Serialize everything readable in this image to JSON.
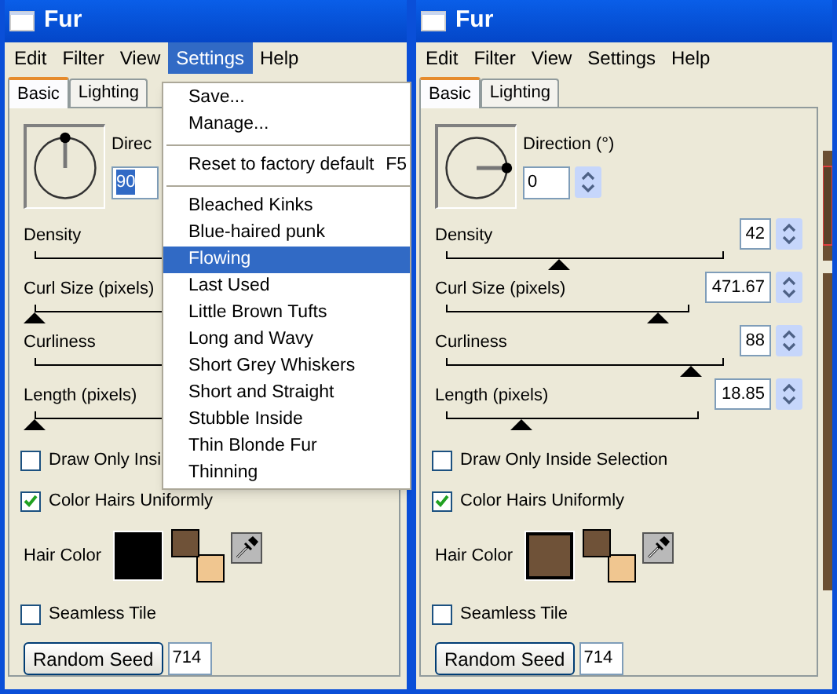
{
  "windows": [
    {
      "title": "Fur",
      "menus": [
        {
          "label": "Edit",
          "selected": false
        },
        {
          "label": "Filter",
          "selected": false
        },
        {
          "label": "View",
          "selected": false
        },
        {
          "label": "Settings",
          "selected": true
        },
        {
          "label": "Help",
          "selected": false
        }
      ],
      "tabs": [
        {
          "label": "Basic",
          "selected": true
        },
        {
          "label": "Lighting",
          "selected": false
        }
      ],
      "direction": {
        "label": "Direc",
        "value": "90",
        "value_selected": true
      },
      "sliders": [
        {
          "label": "Density"
        },
        {
          "label": "Curl Size (pixels)",
          "level": 0
        },
        {
          "label": "Curliness"
        },
        {
          "label": "Length (pixels)",
          "level": 0
        }
      ],
      "checkboxes": [
        {
          "label": "Draw Only Insi",
          "checked": false
        },
        {
          "label": "Color Hairs Uniformly",
          "checked": true
        }
      ],
      "hair_color": {
        "label": "Hair Color",
        "color": "#000000",
        "swatches": [
          {
            "color": "#6f5238"
          },
          {
            "color": "#f0c690"
          }
        ]
      },
      "seamless_tile": {
        "label": "Seamless Tile",
        "checked": false
      },
      "random_seed": {
        "label": "Random Seed",
        "value": "714"
      },
      "open_menu": [
        {
          "kind": "item",
          "label": "Save...",
          "selected": false
        },
        {
          "kind": "item",
          "label": "Manage...",
          "selected": false
        },
        {
          "kind": "separator"
        },
        {
          "kind": "item",
          "label": "Reset to factory default",
          "shortcut": "F5",
          "selected": false
        },
        {
          "kind": "separator"
        },
        {
          "kind": "item",
          "label": "Bleached Kinks",
          "selected": false
        },
        {
          "kind": "item",
          "label": "Blue-haired punk",
          "selected": false
        },
        {
          "kind": "item",
          "label": "Flowing",
          "selected": true
        },
        {
          "kind": "item",
          "label": "Last Used",
          "selected": false
        },
        {
          "kind": "item",
          "label": "Little Brown Tufts",
          "selected": false
        },
        {
          "kind": "item",
          "label": "Long and Wavy",
          "selected": false
        },
        {
          "kind": "item",
          "label": "Short Grey Whiskers",
          "selected": false
        },
        {
          "kind": "item",
          "label": "Short and Straight",
          "selected": false
        },
        {
          "kind": "item",
          "label": "Stubble Inside",
          "selected": false
        },
        {
          "kind": "item",
          "label": "Thin Blonde Fur",
          "selected": false
        },
        {
          "kind": "item",
          "label": "Thinning",
          "selected": false
        }
      ]
    },
    {
      "title": "Fur",
      "menus": [
        {
          "label": "Edit",
          "selected": false
        },
        {
          "label": "Filter",
          "selected": false
        },
        {
          "label": "View",
          "selected": false
        },
        {
          "label": "Settings",
          "selected": false
        },
        {
          "label": "Help",
          "selected": false
        }
      ],
      "tabs": [
        {
          "label": "Basic",
          "selected": true
        },
        {
          "label": "Lighting",
          "selected": false
        }
      ],
      "direction": {
        "label": "Direction (°)",
        "value": "0",
        "value_selected": false
      },
      "sliders": [
        {
          "label": "Density",
          "level": 0.41,
          "value": "42"
        },
        {
          "label": "Curl Size (pixels)",
          "level": 0.87,
          "value": "471.67"
        },
        {
          "label": "Curliness",
          "level": 0.88,
          "value": "88"
        },
        {
          "label": "Length (pixels)",
          "level": 0.3,
          "value": "18.85"
        }
      ],
      "checkboxes": [
        {
          "label": "Draw Only Inside Selection",
          "checked": false
        },
        {
          "label": "Color Hairs Uniformly",
          "checked": true
        }
      ],
      "hair_color": {
        "label": "Hair Color",
        "color": "#6f5238",
        "swatches": [
          {
            "color": "#6f5238"
          },
          {
            "color": "#f0c690"
          }
        ]
      },
      "seamless_tile": {
        "label": "Seamless Tile",
        "checked": false
      },
      "random_seed": {
        "label": "Random Seed",
        "value": "714"
      },
      "preview": {
        "kind": "picture"
      }
    }
  ]
}
